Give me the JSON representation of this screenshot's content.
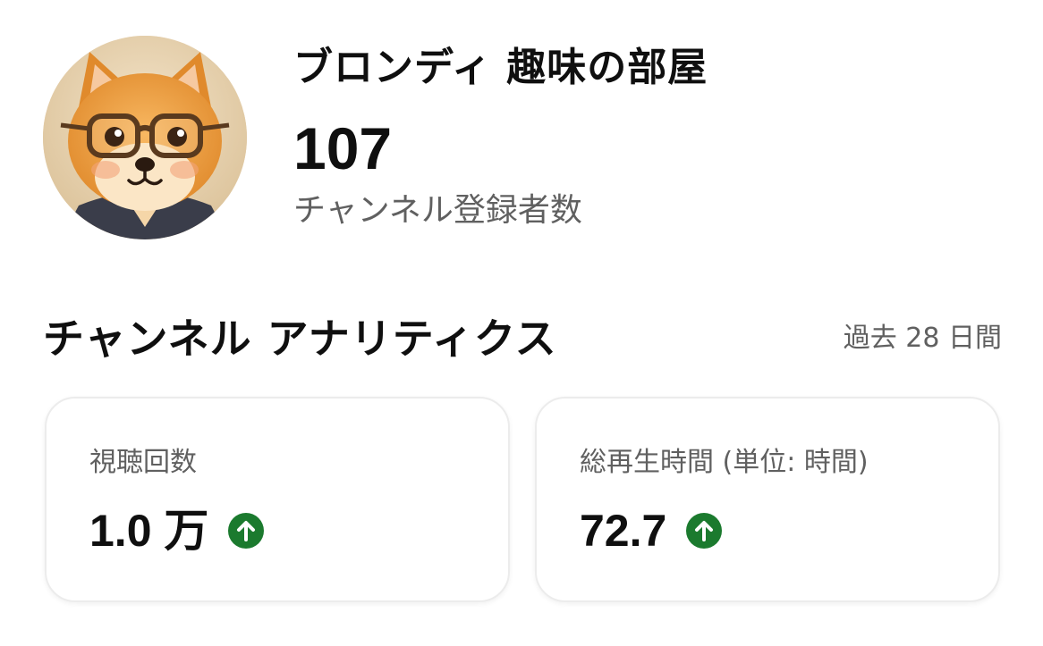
{
  "channel": {
    "name": "ブロンディ 趣味の部屋",
    "subscriber_count": "107",
    "subscriber_label": "チャンネル登録者数"
  },
  "analytics": {
    "title": "チャンネル アナリティクス",
    "period": "過去 28 日間",
    "cards": [
      {
        "label": "視聴回数",
        "value": "1.0 万",
        "trend": "up",
        "trend_icon": "arrow-up-circle-icon"
      },
      {
        "label": "総再生時間 (単位: 時間)",
        "value": "72.7",
        "trend": "up",
        "trend_icon": "arrow-up-circle-icon"
      }
    ]
  },
  "colors": {
    "text_primary": "#0f0f0f",
    "text_secondary": "#606060",
    "trend_up": "#1b7a2e",
    "card_border": "#ececec"
  }
}
